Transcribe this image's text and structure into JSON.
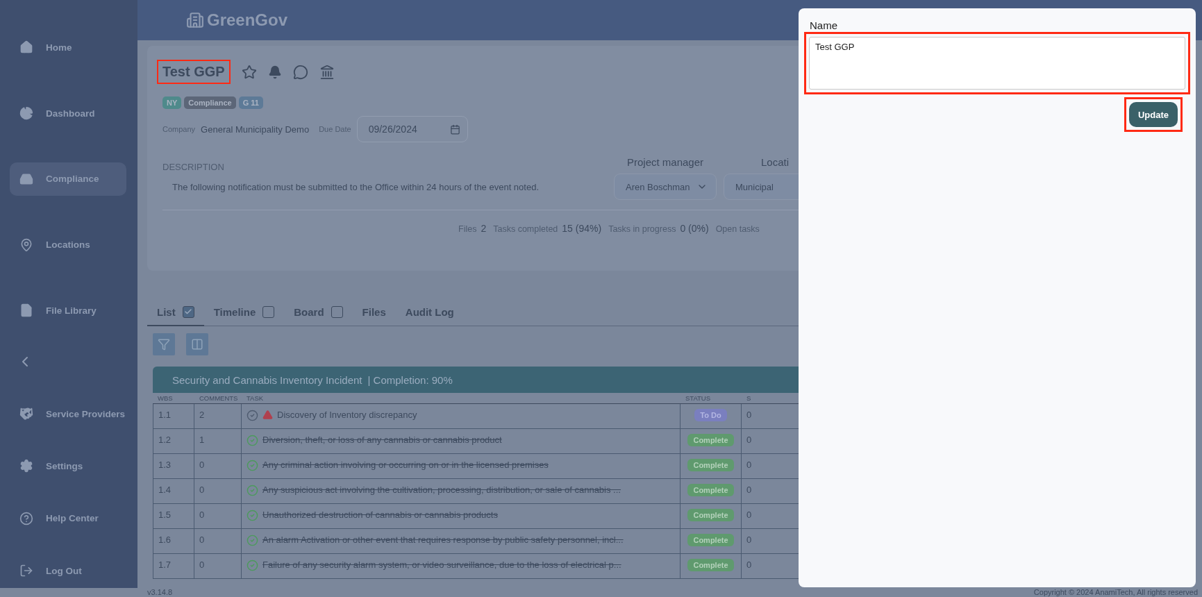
{
  "sidebar": {
    "items": [
      {
        "label": "Home",
        "selected": false
      },
      {
        "label": "Dashboard",
        "selected": false
      },
      {
        "label": "Compliance",
        "selected": true
      },
      {
        "label": "Locations",
        "selected": false
      },
      {
        "label": "File Library",
        "selected": false
      }
    ],
    "bottom_items": [
      {
        "label": "Service Providers"
      },
      {
        "label": "Settings"
      },
      {
        "label": "Help Center"
      },
      {
        "label": "Log Out"
      }
    ]
  },
  "header": {
    "logo": "GreenGov"
  },
  "project": {
    "title": "Test GGP",
    "highlighted": true,
    "tags": [
      {
        "label": "NY",
        "color": "#4f8a8b"
      },
      {
        "label": "Compliance",
        "color": "#5c6678"
      },
      {
        "label": "G 11",
        "color": "#5d7a97"
      }
    ],
    "company_label": "Company",
    "company": "General Municipality Demo",
    "due_label": "Due Date",
    "due_date": "09/26/2024",
    "description_label": "DESCRIPTION",
    "description": "The following notification must be submitted to the Office within 24 hours of the event noted.",
    "project_manager_label": "Project manager",
    "project_manager": "Aren Boschman",
    "location_label": "Locati",
    "location": "Municipal",
    "stats": [
      {
        "label": "Files",
        "value": "2"
      },
      {
        "label": "Tasks completed",
        "value": "15 (94%)"
      },
      {
        "label": "Tasks in progress",
        "value": "0 (0%)"
      },
      {
        "label": "Open tasks"
      }
    ]
  },
  "tabs": [
    {
      "label": "List",
      "selected": true,
      "checked": true
    },
    {
      "label": "Timeline",
      "selected": false,
      "checked": false
    },
    {
      "label": "Board",
      "selected": false,
      "checked": false
    },
    {
      "label": "Files",
      "selected": false
    },
    {
      "label": "Audit Log",
      "selected": false
    }
  ],
  "table": {
    "group_title": "Security and Cannabis Inventory Incident",
    "completion": "| Completion: 90%",
    "columns": [
      "WBS",
      "COMMENTS",
      "TASK",
      "STATUS",
      "S"
    ],
    "rows": [
      {
        "wbs": "1.1",
        "comments": "2",
        "task": "Discovery of Inventory discrepancy",
        "done": false,
        "warning": true,
        "status": "To Do",
        "column_5": "0"
      },
      {
        "wbs": "1.2",
        "comments": "1",
        "task": "Diversion, theft, or loss of any cannabis or cannabis product",
        "done": true,
        "status": "Complete",
        "column_5": "0"
      },
      {
        "wbs": "1.3",
        "comments": "0",
        "task": "Any criminal action involving or occurring on or in the licensed premises",
        "done": true,
        "status": "Complete",
        "column_5": "0"
      },
      {
        "wbs": "1.4",
        "comments": "0",
        "task": "Any suspicious act involving the cultivation, processing, distribution, or sale of cannabis ...",
        "done": true,
        "status": "Complete",
        "column_5": "0"
      },
      {
        "wbs": "1.5",
        "comments": "0",
        "task": "Unauthorized destruction of cannabis or cannabis products",
        "done": true,
        "status": "Complete",
        "column_5": "0"
      },
      {
        "wbs": "1.6",
        "comments": "0",
        "task": "An alarm Activation or other event that requires response by public safety personnel, incl...",
        "done": true,
        "status": "Complete",
        "column_5": "0"
      },
      {
        "wbs": "1.7",
        "comments": "0",
        "task": "Failure of any security alarm system, or video surveillance, due to the loss of electrical p...",
        "done": true,
        "status": "Complete",
        "column_5": "0"
      }
    ]
  },
  "footer": {
    "version": "v3.14.8",
    "copyright": "Copyright © 2024 AnamiTech, All rights reserved"
  },
  "modal": {
    "field_label": "Name",
    "field_value": "Test GGP",
    "field_highlighted": true,
    "button": "Update",
    "button_highlighted": true
  }
}
